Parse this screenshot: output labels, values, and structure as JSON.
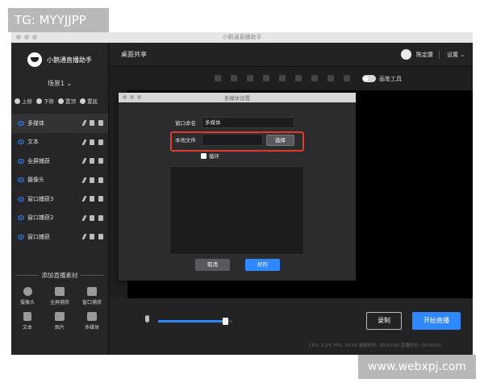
{
  "watermark_top": "TG: MYYJJPP",
  "watermark_bottom": "www.webxpj.com",
  "window": {
    "title": "小鹅通直播助手"
  },
  "sidebar": {
    "brand": "小鹅通直播助手",
    "scene": "场景1 ⌄",
    "ops": [
      "上移",
      "下移",
      "置顶",
      "置底"
    ],
    "sources": [
      {
        "label": "多媒体",
        "active": true
      },
      {
        "label": "文本",
        "active": false
      },
      {
        "label": "全屏捕获",
        "active": false
      },
      {
        "label": "摄像头",
        "active": false
      },
      {
        "label": "窗口捕获3",
        "active": false
      },
      {
        "label": "窗口捕获2",
        "active": false
      },
      {
        "label": "窗口捕获",
        "active": false
      }
    ],
    "add_title": "添加直播素材",
    "add_items": [
      {
        "label": "摄像头",
        "icon": "camera-icon"
      },
      {
        "label": "全屏捕获",
        "icon": "monitor-icon"
      },
      {
        "label": "窗口捕获",
        "icon": "window-icon"
      },
      {
        "label": "文本",
        "icon": "text-icon"
      },
      {
        "label": "图片",
        "icon": "image-icon"
      },
      {
        "label": "多媒体",
        "icon": "media-icon"
      }
    ]
  },
  "topbar": {
    "title": "桌面共享",
    "user": "陈定康",
    "settings": "设置 ⌄"
  },
  "toolbar": {
    "brush_label": "画笔工具"
  },
  "dialog": {
    "title": "多媒体设置",
    "window_name_label": "窗口命名",
    "window_name_value": "多媒体",
    "local_file_label": "本地文件",
    "local_file_value": "",
    "choose_label": "选择",
    "loop_label": "循环",
    "cancel_label": "取消",
    "ok_label": "好的"
  },
  "bottom": {
    "volume": 0.9,
    "record_label": "录制",
    "live_label": "开始直播",
    "status": "CPU: 3.2%  FPS: 30.00  录制时长: 00:00:00  直播时长: 00:00:00"
  },
  "colors": {
    "accent": "#2f88ff",
    "highlight": "#e03c2c"
  }
}
